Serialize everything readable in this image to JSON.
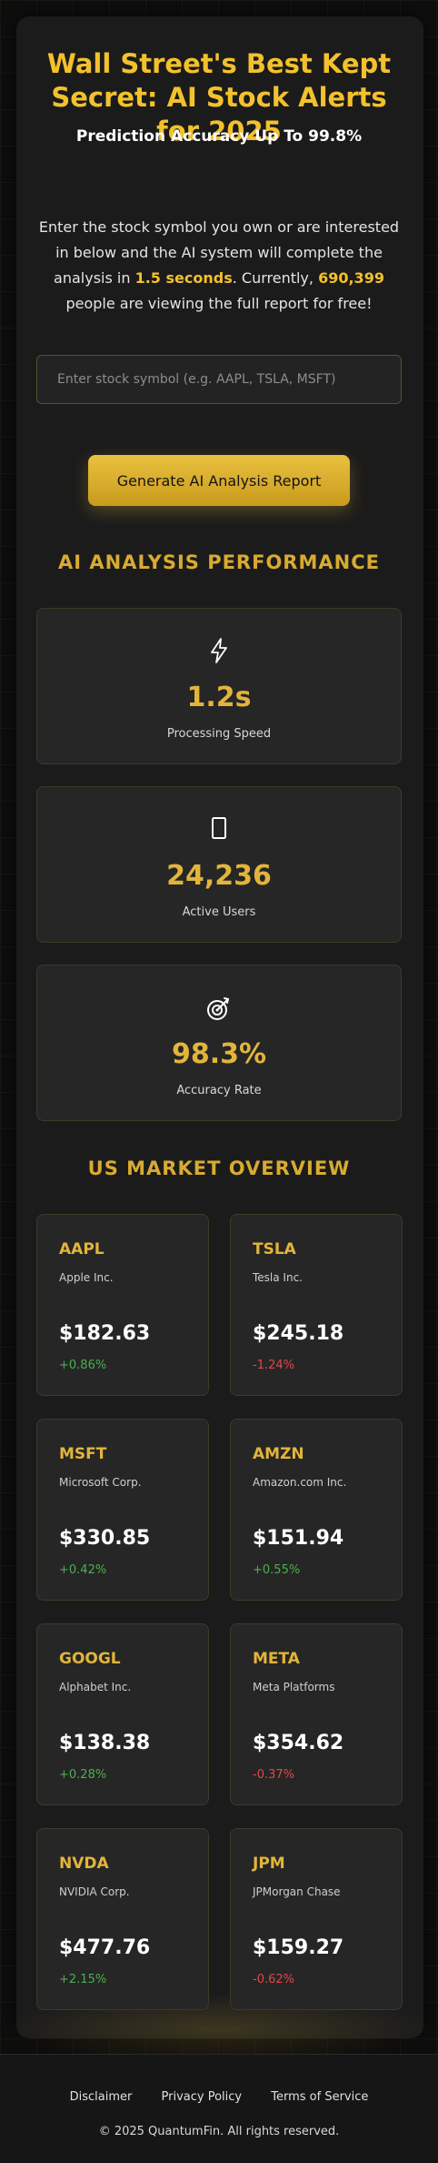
{
  "hero": {
    "title": "Wall Street's Best Kept Secret: AI Stock Alerts for 2025",
    "subtitle": "Prediction Accuracy Up To 99.8%",
    "intro_part1": "Enter the stock symbol you own or are interested in below and the AI system will complete the analysis in ",
    "intro_highlight1": "1.5 seconds",
    "intro_part2": ". Currently, ",
    "intro_highlight2": "690,399",
    "intro_part3": " people are viewing the full report for free!"
  },
  "search": {
    "placeholder": "Enter stock symbol (e.g. AAPL, TSLA, MSFT)",
    "value": ""
  },
  "cta": {
    "label": "Generate AI Analysis Report"
  },
  "performance": {
    "title": "AI ANALYSIS PERFORMANCE",
    "stats": [
      {
        "icon": "lightning-icon",
        "value": "1.2s",
        "label": "Processing Speed"
      },
      {
        "icon": "phone-icon",
        "value": "24,236",
        "label": "Active Users"
      },
      {
        "icon": "target-icon",
        "value": "98.3%",
        "label": "Accuracy Rate"
      }
    ]
  },
  "market": {
    "title": "US MARKET OVERVIEW",
    "stocks": [
      {
        "symbol": "AAPL",
        "name": "Apple Inc.",
        "price": "$182.63",
        "change": "+0.86%",
        "direction": "up"
      },
      {
        "symbol": "TSLA",
        "name": "Tesla Inc.",
        "price": "$245.18",
        "change": "-1.24%",
        "direction": "down"
      },
      {
        "symbol": "MSFT",
        "name": "Microsoft Corp.",
        "price": "$330.85",
        "change": "+0.42%",
        "direction": "up"
      },
      {
        "symbol": "AMZN",
        "name": "Amazon.com Inc.",
        "price": "$151.94",
        "change": "+0.55%",
        "direction": "up"
      },
      {
        "symbol": "GOOGL",
        "name": "Alphabet Inc.",
        "price": "$138.38",
        "change": "+0.28%",
        "direction": "up"
      },
      {
        "symbol": "META",
        "name": "Meta Platforms",
        "price": "$354.62",
        "change": "-0.37%",
        "direction": "down"
      },
      {
        "symbol": "NVDA",
        "name": "NVIDIA Corp.",
        "price": "$477.76",
        "change": "+2.15%",
        "direction": "up"
      },
      {
        "symbol": "JPM",
        "name": "JPMorgan Chase",
        "price": "$159.27",
        "change": "-0.62%",
        "direction": "down"
      }
    ]
  },
  "footer": {
    "links": [
      "Disclaimer",
      "Privacy Policy",
      "Terms of Service"
    ],
    "copyright": "© 2025 QuantumFin. All rights reserved."
  },
  "colors": {
    "accent": "#f3c12c",
    "gain": "#4caf50",
    "loss": "#e04848",
    "background": "#0e0e0e",
    "panel": "#1b1b1b"
  }
}
